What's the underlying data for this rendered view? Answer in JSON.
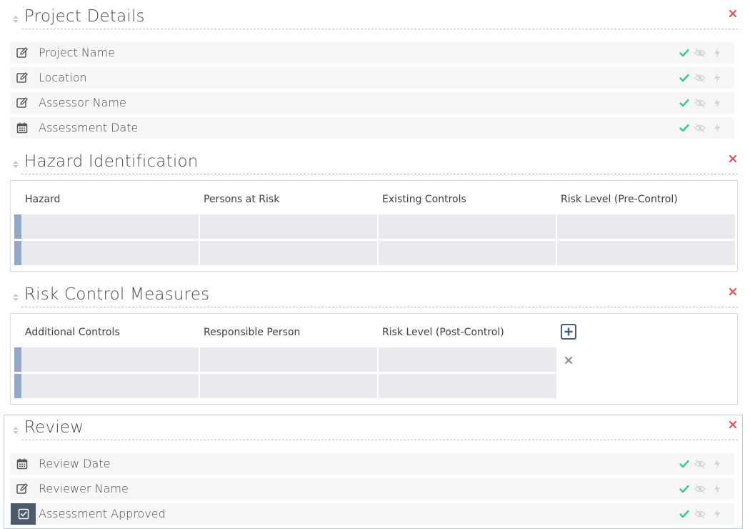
{
  "sections": {
    "project_details": {
      "title": "Project Details",
      "fields": [
        {
          "label": "Project Name",
          "icon": "edit-icon"
        },
        {
          "label": "Location",
          "icon": "edit-icon"
        },
        {
          "label": "Assessor Name",
          "icon": "edit-icon"
        },
        {
          "label": "Assessment Date",
          "icon": "calendar-icon"
        }
      ]
    },
    "hazard_identification": {
      "title": "Hazard Identification",
      "columns": [
        "Hazard",
        "Persons at Risk",
        "Existing Controls",
        "Risk Level (Pre-Control)"
      ],
      "rows": [
        [
          "",
          "",
          "",
          ""
        ],
        [
          "",
          "",
          "",
          ""
        ]
      ]
    },
    "risk_control_measures": {
      "title": "Risk Control Measures",
      "columns": [
        "Additional Controls",
        "Responsible Person",
        "Risk Level (Post-Control)"
      ],
      "rows": [
        [
          "",
          "",
          ""
        ],
        [
          "",
          "",
          ""
        ]
      ]
    },
    "review": {
      "title": "Review",
      "fields": [
        {
          "label": "Review Date",
          "icon": "calendar-icon"
        },
        {
          "label": "Reviewer Name",
          "icon": "edit-icon"
        },
        {
          "label": "Assessment Approved",
          "icon": "checkbox-icon"
        }
      ]
    }
  },
  "colors": {
    "accent_check": "#2ecc8f",
    "close_red": "#e05252",
    "row_handle": "#93a8c9",
    "cell_bg": "#e9eaed",
    "muted_icon": "#cfcfcf",
    "add_button": "#3f5f8f"
  }
}
